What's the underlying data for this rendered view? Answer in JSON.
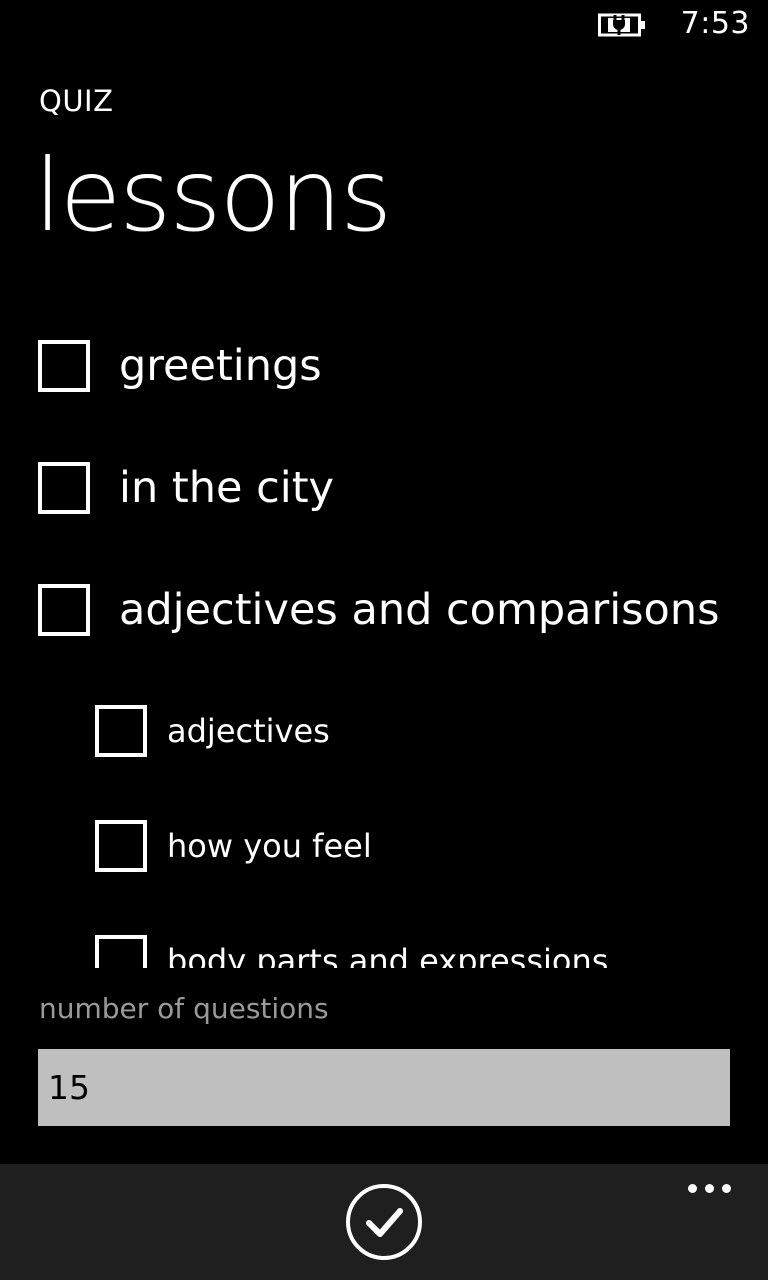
{
  "status_bar": {
    "time": "7:53",
    "battery_icon": "battery-charging-icon"
  },
  "header": {
    "app_title": "QUIZ",
    "page_title": "lessons"
  },
  "lessons": [
    {
      "label": "greetings",
      "level": 1,
      "checked": false
    },
    {
      "label": "in the city",
      "level": 1,
      "checked": false
    },
    {
      "label": "adjectives and comparisons",
      "level": 1,
      "checked": false
    },
    {
      "label": "adjectives",
      "level": 2,
      "checked": false
    },
    {
      "label": "how you feel",
      "level": 2,
      "checked": false
    },
    {
      "label": "body parts and expressions",
      "level": 2,
      "checked": false
    }
  ],
  "questions": {
    "label": "number of questions",
    "value": "15"
  },
  "app_bar": {
    "confirm_icon": "check-circle-icon",
    "more_icon": "ellipsis-icon"
  }
}
